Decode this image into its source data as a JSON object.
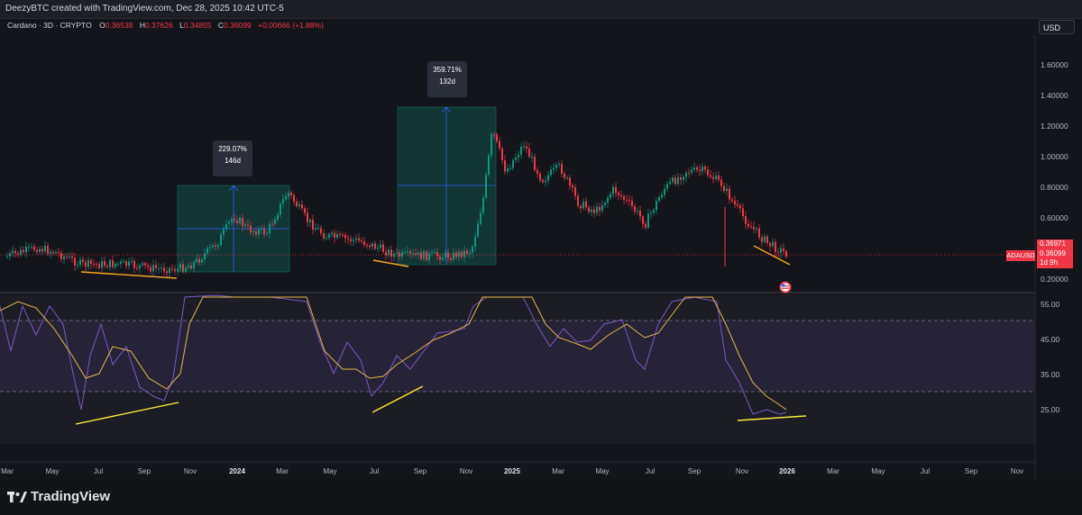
{
  "header": {
    "credit": "DeezyBTC created with TradingView.com, Dec 28, 2025 10:42 UTC-5"
  },
  "symbol": {
    "name": "Cardano · 3D · CRYPTO",
    "open_label": "O",
    "open": "0.36538",
    "high_label": "H",
    "high": "0.37626",
    "low_label": "L",
    "low": "0.34855",
    "close_label": "C",
    "close": "0.36099",
    "change": "+0.00666 (+1.88%)"
  },
  "currency": "USD",
  "price_axis": [
    "1.60000",
    "1.40000",
    "1.20000",
    "1.00000",
    "0.80000",
    "0.60000",
    "0.20000"
  ],
  "price_badge": {
    "ticker": "ADAUSD",
    "price1": "0.36971",
    "price2": "0.36099",
    "countdown": "1d 9h"
  },
  "rsi_axis": [
    "55.00",
    "45.00",
    "35.00",
    "25.00"
  ],
  "time_axis": [
    {
      "label": "Mar",
      "year": false
    },
    {
      "label": "May",
      "year": false
    },
    {
      "label": "Jul",
      "year": false
    },
    {
      "label": "Sep",
      "year": false
    },
    {
      "label": "Nov",
      "year": false
    },
    {
      "label": "2024",
      "year": true
    },
    {
      "label": "Mar",
      "year": false
    },
    {
      "label": "May",
      "year": false
    },
    {
      "label": "Jul",
      "year": false
    },
    {
      "label": "Sep",
      "year": false
    },
    {
      "label": "Nov",
      "year": false
    },
    {
      "label": "2025",
      "year": true
    },
    {
      "label": "Mar",
      "year": false
    },
    {
      "label": "May",
      "year": false
    },
    {
      "label": "Jul",
      "year": false
    },
    {
      "label": "Sep",
      "year": false
    },
    {
      "label": "Nov",
      "year": false
    },
    {
      "label": "2026",
      "year": true
    },
    {
      "label": "Mar",
      "year": false
    },
    {
      "label": "May",
      "year": false
    },
    {
      "label": "Jul",
      "year": false
    },
    {
      "label": "Sep",
      "year": false
    },
    {
      "label": "Nov",
      "year": false
    }
  ],
  "measures": [
    {
      "percent": "229.07%",
      "duration": "146d"
    },
    {
      "percent": "359.71%",
      "duration": "132d"
    }
  ],
  "brand": "TradingView",
  "colors": {
    "up": "#089981",
    "down": "#f23645",
    "rsi": "#7e57c2",
    "rsi_ma": "#e6b84a",
    "trendline": "#ffeb3b",
    "support": "#f5a623"
  }
}
